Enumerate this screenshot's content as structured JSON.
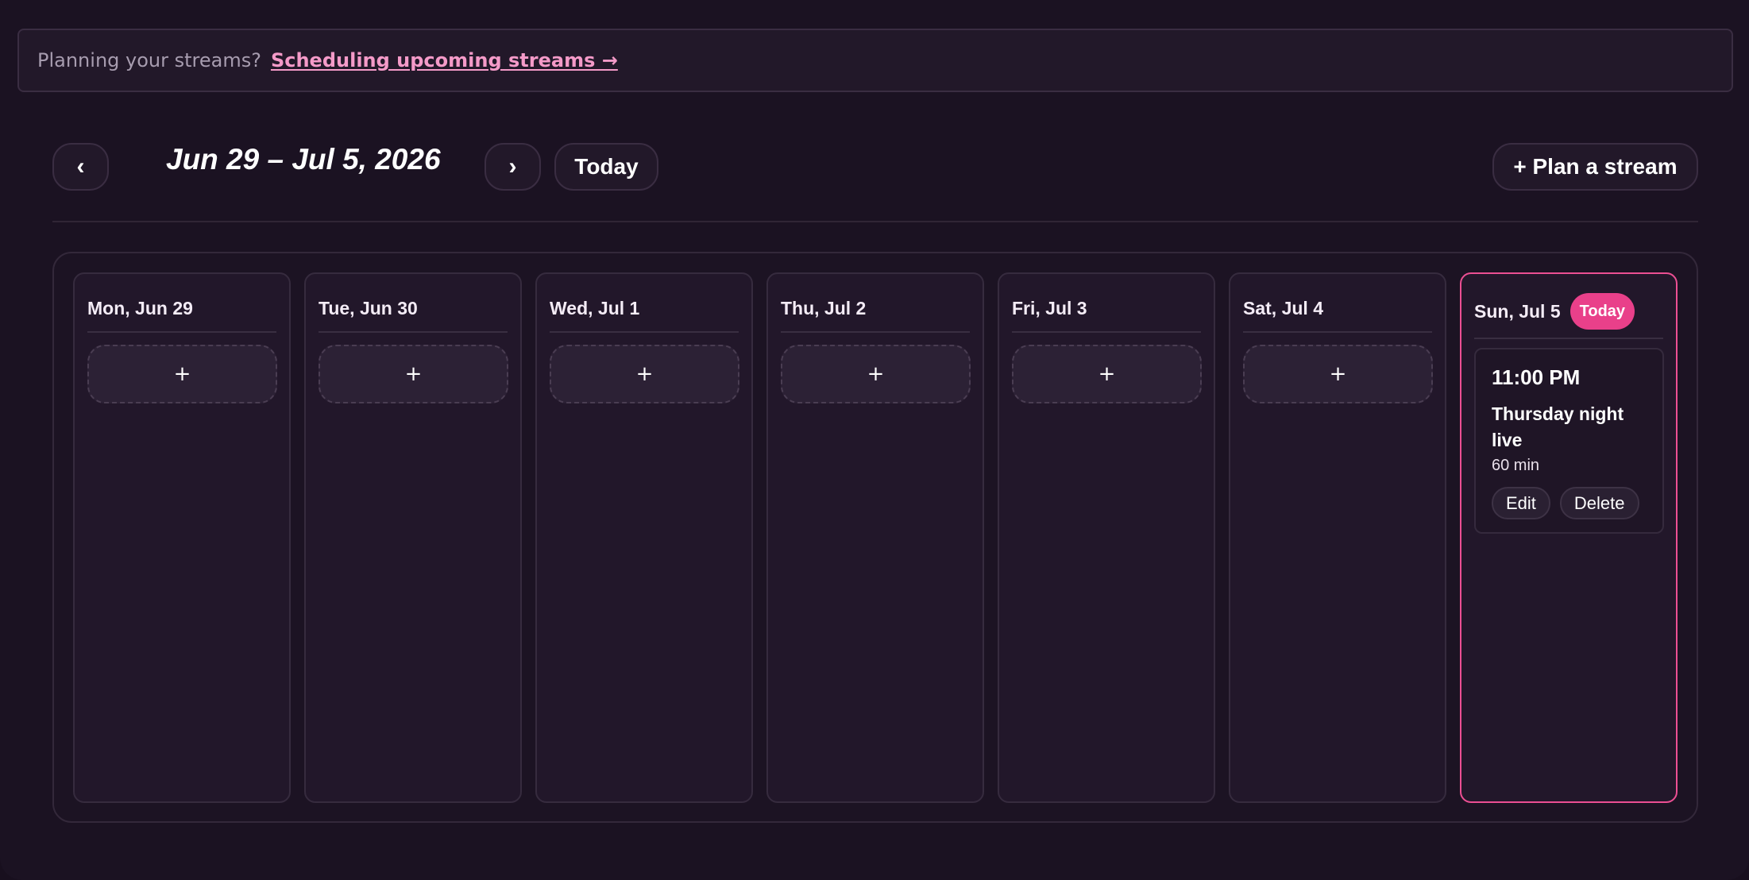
{
  "banner": {
    "text": "Planning your streams?",
    "link": "Scheduling upcoming streams →"
  },
  "toolbar": {
    "prev_label": "‹",
    "range_title": "Jun 29 – Jul 5, 2026",
    "next_label": "›",
    "today_label": "Today",
    "plan_label": "+ Plan a stream"
  },
  "week": {
    "days": [
      {
        "label": "Mon, Jun 29",
        "add_label": "+"
      },
      {
        "label": "Tue, Jun 30",
        "add_label": "+"
      },
      {
        "label": "Wed, Jul 1",
        "add_label": "+"
      },
      {
        "label": "Thu, Jul 2",
        "add_label": "+"
      },
      {
        "label": "Fri, Jul 3",
        "add_label": "+"
      },
      {
        "label": "Sat, Jul 4",
        "add_label": "+"
      },
      {
        "label": "Sun, Jul 5",
        "badge": "Today"
      }
    ],
    "event": {
      "time": "11:00 PM",
      "title": "Thursday night live",
      "duration": "60 min",
      "edit_label": "Edit",
      "delete_label": "Delete"
    }
  },
  "colors": {
    "accent": "#e9408a",
    "link": "#f49ac8",
    "background": "#1b1222"
  }
}
